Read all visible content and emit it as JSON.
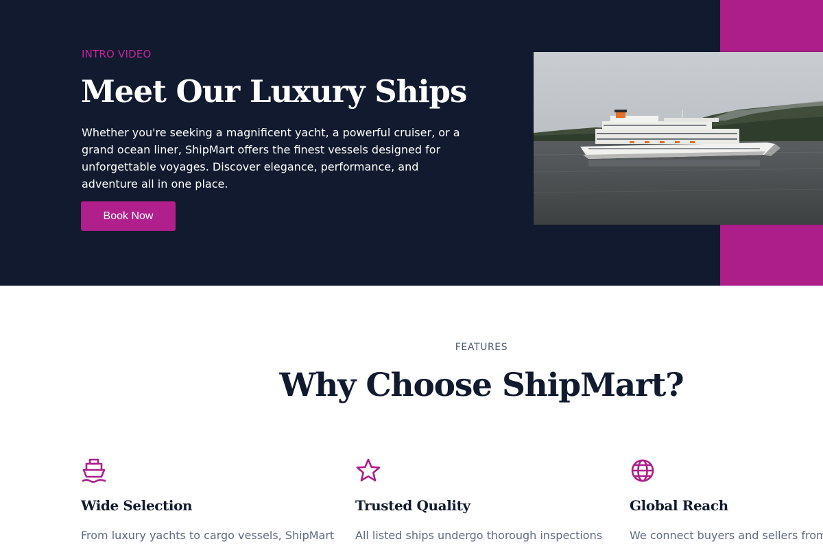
{
  "hero": {
    "eyebrow": "INTRO VIDEO",
    "title": "Meet Our Luxury Ships",
    "description": "Whether you're seeking a magnificent yacht, a powerful cruiser, or a grand ocean liner, ShipMart offers the finest vessels designed for unforgettable voyages. Discover elegance, performance, and adventure all in one place.",
    "cta_label": "Book Now"
  },
  "features": {
    "eyebrow": "FEATURES",
    "title": "Why Choose ShipMart?",
    "items": [
      {
        "icon": "ship-icon",
        "title": "Wide Selection",
        "description": "From luxury yachts to cargo vessels, ShipMart"
      },
      {
        "icon": "star-icon",
        "title": "Trusted Quality",
        "description": "All listed ships undergo thorough inspections"
      },
      {
        "icon": "globe-icon",
        "title": "Global Reach",
        "description": "We connect buyers and sellers from"
      }
    ]
  },
  "colors": {
    "navy": "#111a2e",
    "accent": "#ad1e8a",
    "muted_text": "#5c6a82"
  }
}
